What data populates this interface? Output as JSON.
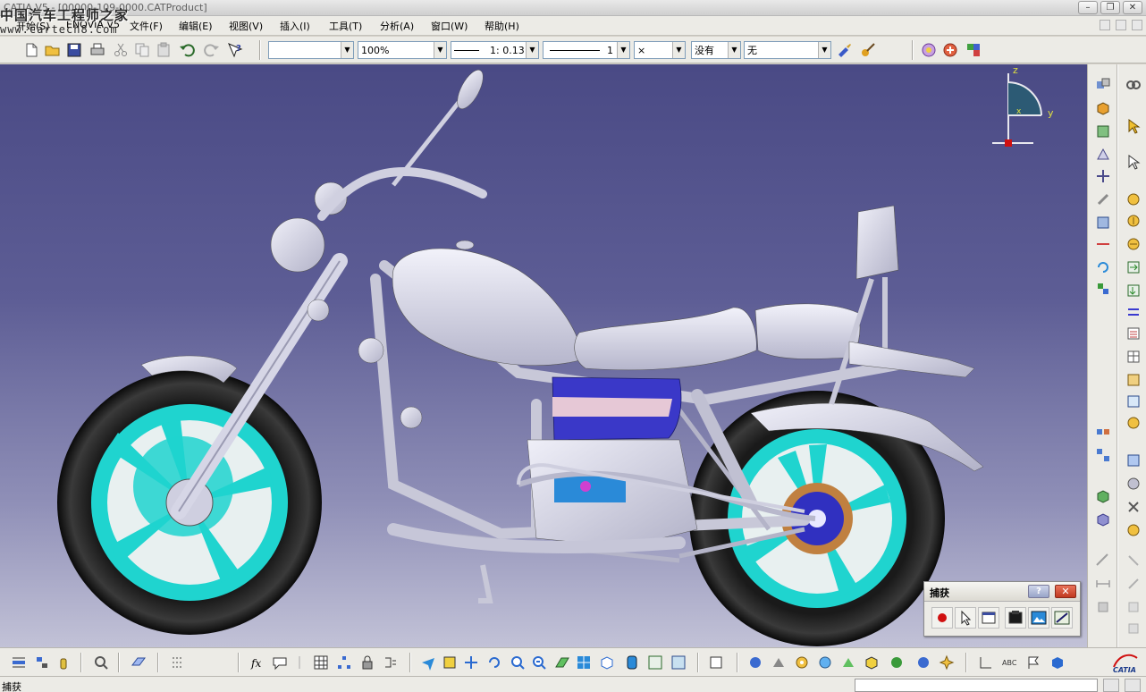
{
  "title_bar": {
    "title": "CATIA V5 - [00000-109-0000.CATProduct]",
    "buttons": [
      "–",
      "❐",
      "✕"
    ]
  },
  "watermark": {
    "line1": "中国汽车工程师之家",
    "line2": "www.cartech8.com"
  },
  "menu": {
    "items": [
      "开始(S)",
      "ENOVIA V5",
      "文件(F)",
      "编辑(E)",
      "视图(V)",
      "插入(I)",
      "工具(T)",
      "分析(A)",
      "窗口(W)",
      "帮助(H)"
    ]
  },
  "toolbar": {
    "color_combo": "",
    "transparency_combo": "100%",
    "linetype_combo": "1: 0.13",
    "thickness_combo": "1",
    "point_combo": "×",
    "layer_combo": "没有",
    "render_combo": "无"
  },
  "compass": {
    "z_label": "z",
    "y_label": "y",
    "x_label": "x"
  },
  "capture_palette": {
    "title": "捕获",
    "help_label": "?",
    "close_label": "✕"
  },
  "status_bar": {
    "message": "捕获"
  },
  "colors": {
    "viewport_top": "#4a4a85",
    "viewport_bottom": "#c2c2d7",
    "part_gray": "#d8d8e8",
    "wheel_cyan": "#1fd4cf",
    "tank_blue": "#3a38c8",
    "stripe_pink": "#e6c8d6"
  }
}
